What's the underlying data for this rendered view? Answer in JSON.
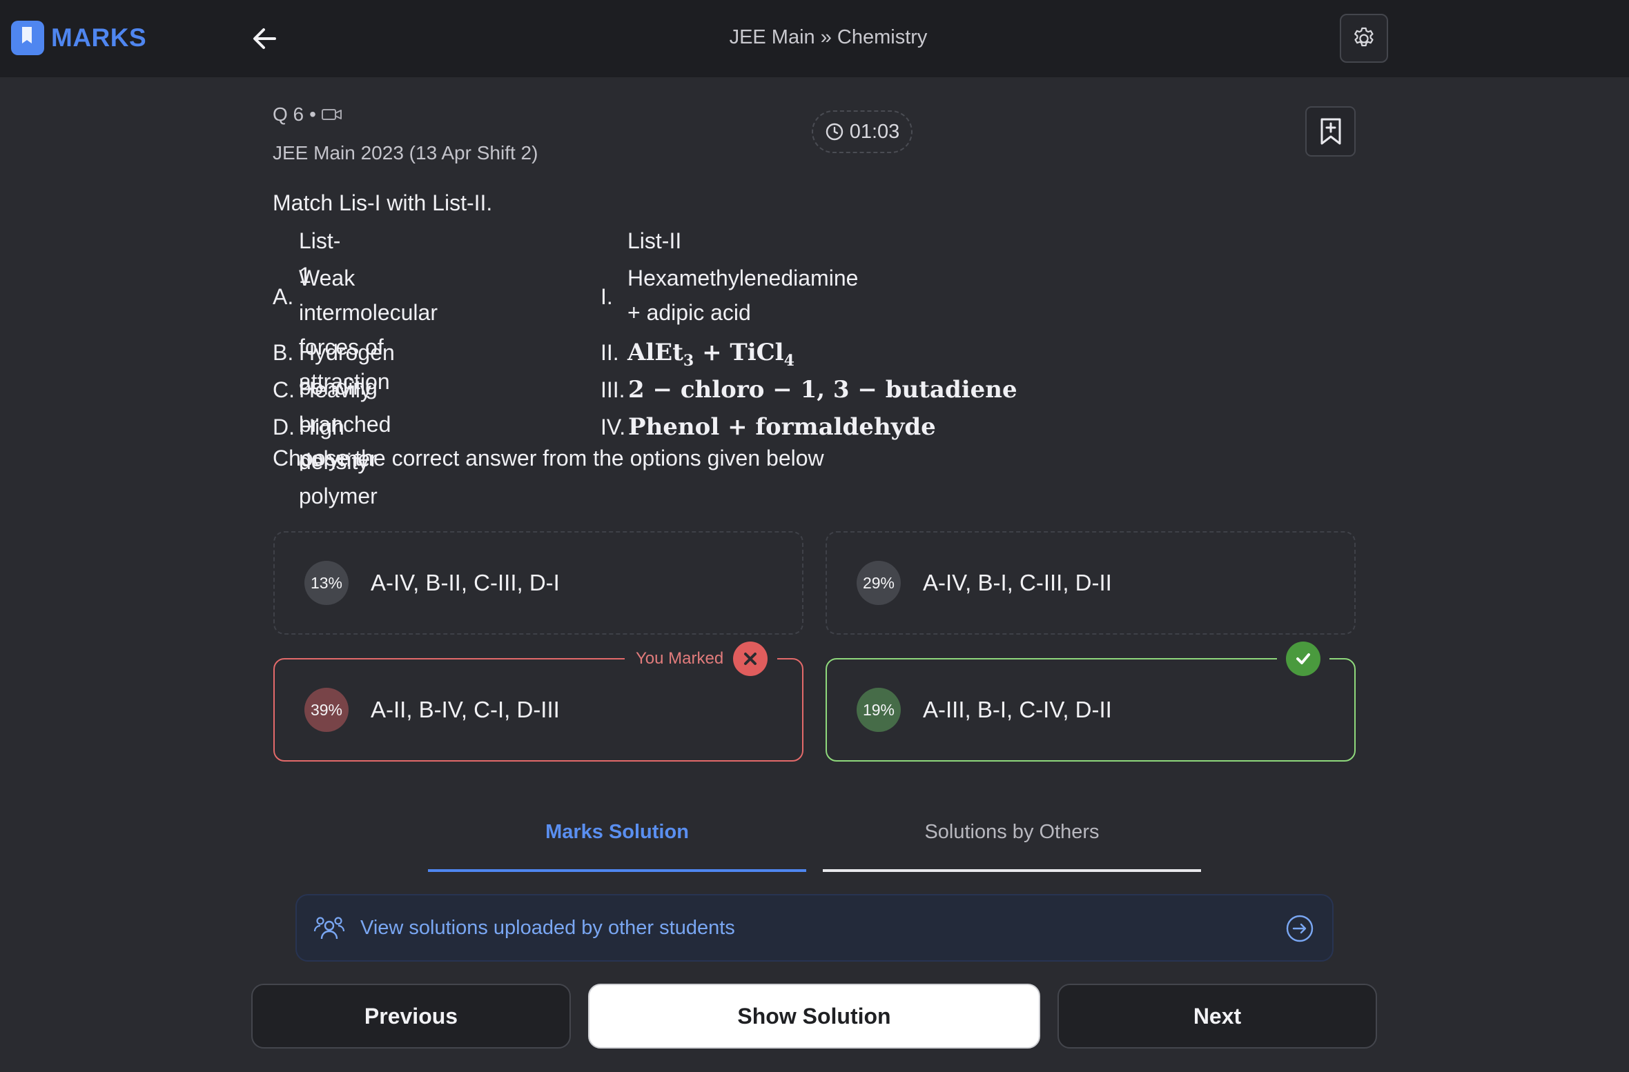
{
  "header": {
    "brand": "MARKS",
    "breadcrumb": "JEE Main » Chemistry",
    "icons": [
      "back-arrow-icon",
      "gear-icon"
    ]
  },
  "question": {
    "number": "Q 6",
    "separator": "•",
    "media_icon": "video-icon",
    "exam": "JEE Main 2023 (13 Apr Shift 2)",
    "timer": "01:03",
    "prompt": "Match Lis-I with List-II.",
    "list1_header": "List-1",
    "list2_header": "List-II",
    "rows": [
      {
        "l1": "A.",
        "c1_line1": "Weak intermolecular forces of",
        "c1_line2": "attraction",
        "l2": "I.",
        "c2_line1": "Hexamethylenediamine",
        "c2_line2": "+ adipic acid"
      },
      {
        "l1": "B.",
        "c1": "Hydrogen bonding",
        "l2": "II.",
        "c2_a": "AlEt",
        "c2_a_sub": "3",
        "c2_plus": " + TiCl",
        "c2_b_sub": "4"
      },
      {
        "l1": "C.",
        "c1": "Heavily branched polymer",
        "l2": "III.",
        "c2": "2 − chloro − 1,  3 − butadiene"
      },
      {
        "l1": "D.",
        "c1": "High density polymer",
        "l2": "IV.",
        "c2": "Phenol  +  formaldehyde"
      }
    ],
    "choose": "Choose the correct answer from the options given below"
  },
  "options": [
    {
      "pct": "13%",
      "text": "A-IV, B-II, C-III, D-I",
      "state": "neutral"
    },
    {
      "pct": "29%",
      "text": "A-IV, B-I, C-III, D-II",
      "state": "neutral"
    },
    {
      "pct": "39%",
      "text": "A-II, B-IV, C-I, D-III",
      "state": "wrong"
    },
    {
      "pct": "19%",
      "text": "A-III, B-I, C-IV, D-II",
      "state": "correct"
    }
  ],
  "marked_label": "You Marked",
  "tabs": [
    {
      "label": "Marks Solution",
      "active": true
    },
    {
      "label": "Solutions by Others",
      "active": false
    }
  ],
  "banner": {
    "text": "View solutions uploaded by other students",
    "icon": "people-icon",
    "action_icon": "arrow-circle-icon"
  },
  "buttons": {
    "previous": "Previous",
    "show_solution": "Show Solution",
    "next": "Next"
  },
  "colors": {
    "accent": "#4f86f0",
    "wrong": "#e05d5d",
    "correct": "#4a9a3e",
    "background": "#2a2b30",
    "topbar": "#1d1e22"
  }
}
